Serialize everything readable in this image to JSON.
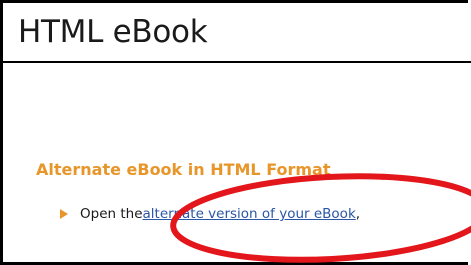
{
  "page": {
    "title": "HTML eBook"
  },
  "section": {
    "heading": "Alternate eBook in HTML Format"
  },
  "list": {
    "item_prefix": "Open the ",
    "item_link": "alternate version of your eBook",
    "item_suffix": ","
  },
  "colors": {
    "accent": "#e8962a",
    "link": "#2a56a8",
    "annotation": "#e3161b"
  },
  "icons": {
    "bullet": "triangle-right-bullet-icon",
    "annotation": "red-ellipse-highlight"
  }
}
